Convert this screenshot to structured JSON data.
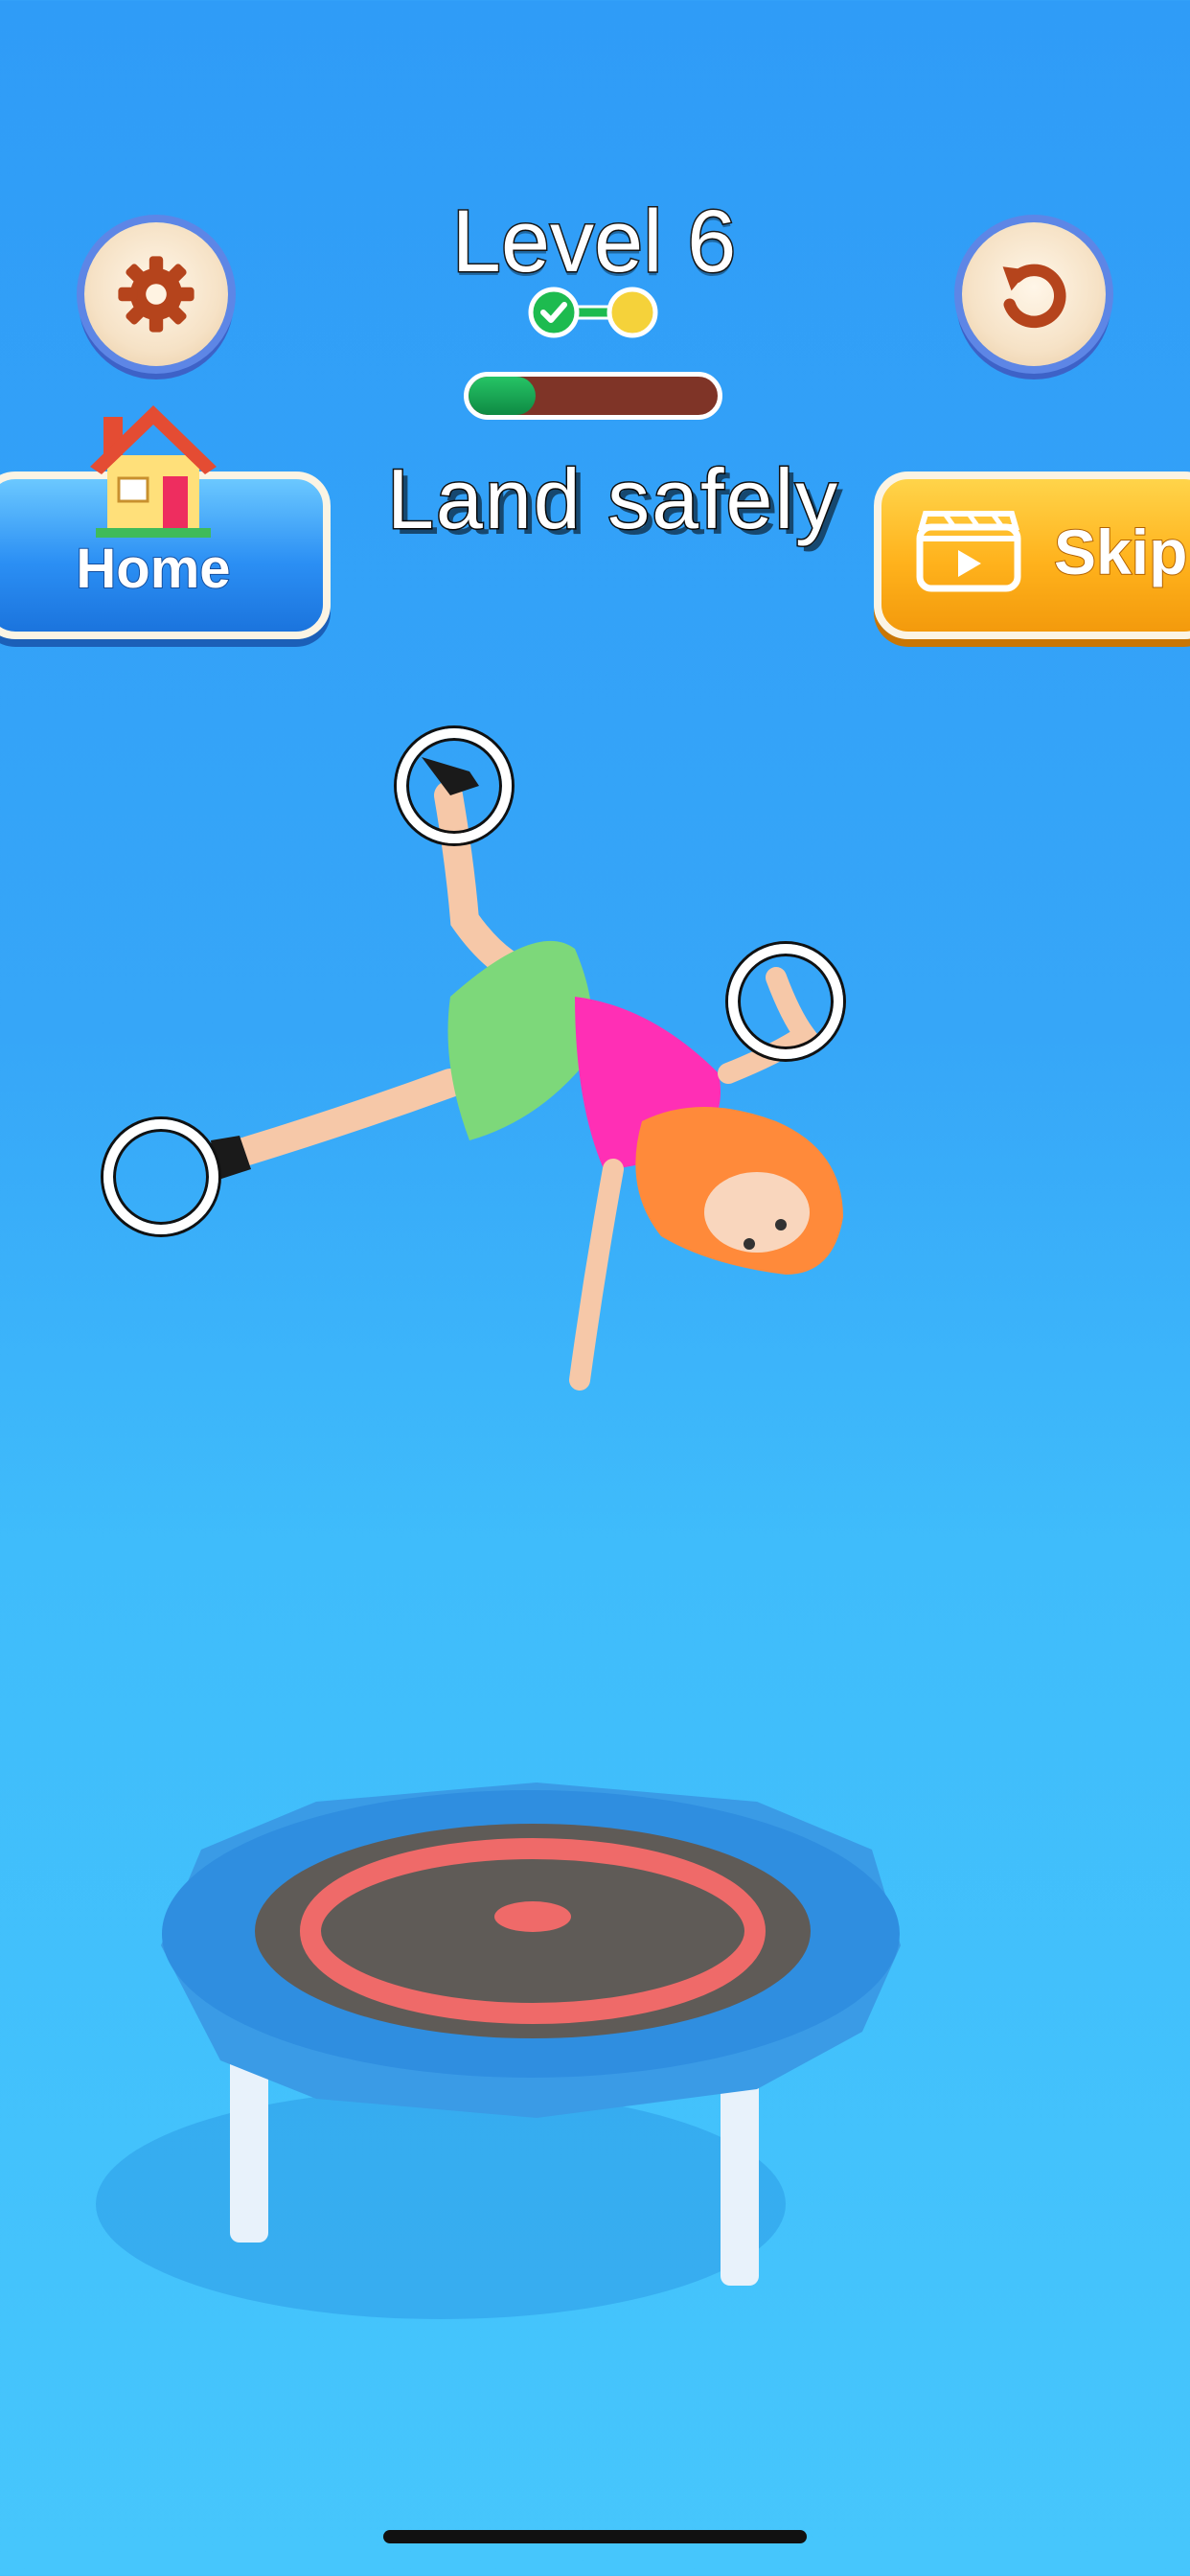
{
  "header": {
    "level_title": "Level 6",
    "stages": {
      "completed": 1,
      "total": 2
    },
    "progress": 0.27,
    "instruction": "Land safely"
  },
  "buttons": {
    "settings_icon": "gear-icon",
    "restart_icon": "restart-icon",
    "home_label": "Home",
    "home_icon": "house-icon",
    "skip_label": "Skip",
    "skip_icon": "video-ad-icon"
  },
  "colors": {
    "progress_fill": "#16a34f",
    "progress_track": "#7f3427",
    "home_button": "#2b8ff4",
    "skip_button": "#ffb21c",
    "icon_brown": "#b5441c"
  }
}
